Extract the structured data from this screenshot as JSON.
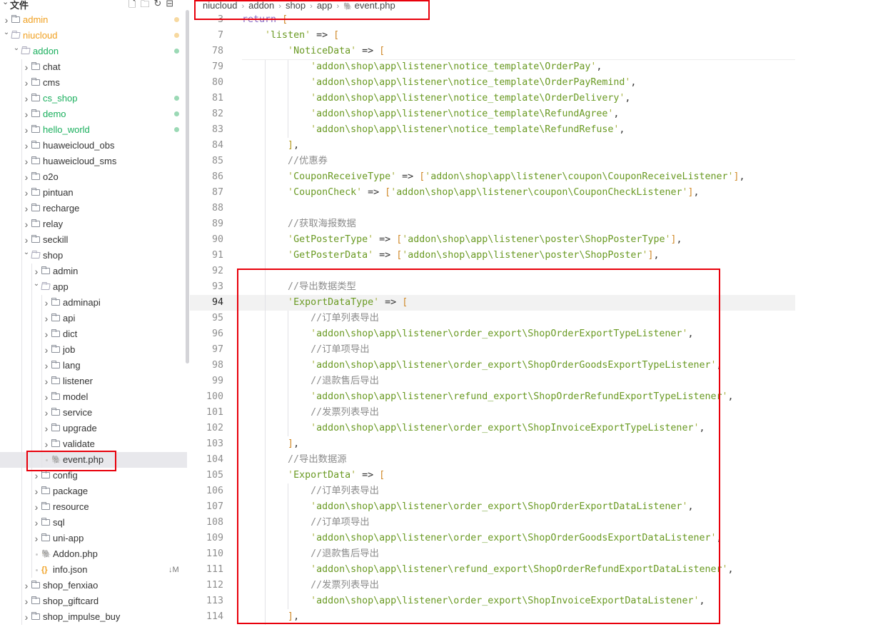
{
  "sidebar": {
    "title": "文件",
    "header_icons": [
      "new-file-icon",
      "new-folder-icon",
      "refresh-icon",
      "collapse-all-icon"
    ],
    "items": [
      {
        "label": "admin",
        "depth": 0,
        "type": "folder",
        "open": false,
        "color": "#f0a020",
        "badge_color": "#f7d9a0"
      },
      {
        "label": "niucloud",
        "depth": 0,
        "type": "folder",
        "open": true,
        "color": "#f0a020",
        "badge_color": "#f7d9a0"
      },
      {
        "label": "addon",
        "depth": 1,
        "type": "folder",
        "open": true,
        "color": "#1aaf5d",
        "badge_color": "#9bd9b5"
      },
      {
        "label": "chat",
        "depth": 2,
        "type": "folder",
        "open": false
      },
      {
        "label": "cms",
        "depth": 2,
        "type": "folder",
        "open": false
      },
      {
        "label": "cs_shop",
        "depth": 2,
        "type": "folder",
        "open": false,
        "color": "#1aaf5d",
        "badge_color": "#9bd9b5"
      },
      {
        "label": "demo",
        "depth": 2,
        "type": "folder",
        "open": false,
        "color": "#1aaf5d",
        "badge_color": "#9bd9b5"
      },
      {
        "label": "hello_world",
        "depth": 2,
        "type": "folder",
        "open": false,
        "color": "#1aaf5d",
        "badge_color": "#9bd9b5"
      },
      {
        "label": "huaweicloud_obs",
        "depth": 2,
        "type": "folder",
        "open": false
      },
      {
        "label": "huaweicloud_sms",
        "depth": 2,
        "type": "folder",
        "open": false
      },
      {
        "label": "o2o",
        "depth": 2,
        "type": "folder",
        "open": false
      },
      {
        "label": "pintuan",
        "depth": 2,
        "type": "folder",
        "open": false
      },
      {
        "label": "recharge",
        "depth": 2,
        "type": "folder",
        "open": false
      },
      {
        "label": "relay",
        "depth": 2,
        "type": "folder",
        "open": false
      },
      {
        "label": "seckill",
        "depth": 2,
        "type": "folder",
        "open": false
      },
      {
        "label": "shop",
        "depth": 2,
        "type": "folder",
        "open": true
      },
      {
        "label": "admin",
        "depth": 3,
        "type": "folder",
        "open": false
      },
      {
        "label": "app",
        "depth": 3,
        "type": "folder",
        "open": true
      },
      {
        "label": "adminapi",
        "depth": 4,
        "type": "folder",
        "open": false
      },
      {
        "label": "api",
        "depth": 4,
        "type": "folder",
        "open": false
      },
      {
        "label": "dict",
        "depth": 4,
        "type": "folder",
        "open": false
      },
      {
        "label": "job",
        "depth": 4,
        "type": "folder",
        "open": false
      },
      {
        "label": "lang",
        "depth": 4,
        "type": "folder",
        "open": false
      },
      {
        "label": "listener",
        "depth": 4,
        "type": "folder",
        "open": false
      },
      {
        "label": "model",
        "depth": 4,
        "type": "folder",
        "open": false
      },
      {
        "label": "service",
        "depth": 4,
        "type": "folder",
        "open": false
      },
      {
        "label": "upgrade",
        "depth": 4,
        "type": "folder",
        "open": false
      },
      {
        "label": "validate",
        "depth": 4,
        "type": "folder",
        "open": false
      },
      {
        "label": "event.php",
        "depth": 4,
        "type": "php",
        "selected": true
      },
      {
        "label": "config",
        "depth": 3,
        "type": "folder",
        "open": false
      },
      {
        "label": "package",
        "depth": 3,
        "type": "folder",
        "open": false
      },
      {
        "label": "resource",
        "depth": 3,
        "type": "folder",
        "open": false
      },
      {
        "label": "sql",
        "depth": 3,
        "type": "folder",
        "open": false
      },
      {
        "label": "uni-app",
        "depth": 3,
        "type": "folder",
        "open": false
      },
      {
        "label": "Addon.php",
        "depth": 3,
        "type": "php"
      },
      {
        "label": "info.json",
        "depth": 3,
        "type": "json",
        "badge_text": "↓M"
      },
      {
        "label": "shop_fenxiao",
        "depth": 2,
        "type": "folder",
        "open": false
      },
      {
        "label": "shop_giftcard",
        "depth": 2,
        "type": "folder",
        "open": false
      },
      {
        "label": "shop_impulse_buy",
        "depth": 2,
        "type": "folder",
        "open": false
      }
    ]
  },
  "breadcrumb": [
    "niucloud",
    "addon",
    "shop",
    "app",
    "event.php"
  ],
  "editor": {
    "current_line": 94,
    "lines": [
      {
        "n": 3,
        "i": 0,
        "s": [
          [
            "k",
            "return"
          ],
          [
            "o",
            " "
          ],
          [
            "b",
            "["
          ]
        ]
      },
      {
        "n": 7,
        "i": 1,
        "s": [
          [
            "q",
            "'"
          ],
          [
            "s",
            "listen"
          ],
          [
            "q",
            "'"
          ],
          [
            "o",
            " => "
          ],
          [
            "b",
            "["
          ]
        ]
      },
      {
        "n": 78,
        "i": 2,
        "s": [
          [
            "q",
            "'"
          ],
          [
            "s",
            "NoticeData"
          ],
          [
            "q",
            "'"
          ],
          [
            "o",
            " => "
          ],
          [
            "b",
            "["
          ]
        ]
      },
      {
        "n": 79,
        "i": 3,
        "s": [
          [
            "q",
            "'"
          ],
          [
            "s",
            "addon\\shop\\app\\listener\\notice_template\\OrderPay"
          ],
          [
            "q",
            "'"
          ],
          [
            "o",
            ","
          ]
        ]
      },
      {
        "n": 80,
        "i": 3,
        "s": [
          [
            "q",
            "'"
          ],
          [
            "s",
            "addon\\shop\\app\\listener\\notice_template\\OrderPayRemind"
          ],
          [
            "q",
            "'"
          ],
          [
            "o",
            ","
          ]
        ]
      },
      {
        "n": 81,
        "i": 3,
        "s": [
          [
            "q",
            "'"
          ],
          [
            "s",
            "addon\\shop\\app\\listener\\notice_template\\OrderDelivery"
          ],
          [
            "q",
            "'"
          ],
          [
            "o",
            ","
          ]
        ]
      },
      {
        "n": 82,
        "i": 3,
        "s": [
          [
            "q",
            "'"
          ],
          [
            "s",
            "addon\\shop\\app\\listener\\notice_template\\RefundAgree"
          ],
          [
            "q",
            "'"
          ],
          [
            "o",
            ","
          ]
        ]
      },
      {
        "n": 83,
        "i": 3,
        "s": [
          [
            "q",
            "'"
          ],
          [
            "s",
            "addon\\shop\\app\\listener\\notice_template\\RefundRefuse"
          ],
          [
            "q",
            "'"
          ],
          [
            "o",
            ","
          ]
        ]
      },
      {
        "n": 84,
        "i": 2,
        "s": [
          [
            "p",
            "]"
          ],
          [
            "o",
            ","
          ]
        ]
      },
      {
        "n": 85,
        "i": 2,
        "s": [
          [
            "c",
            "//优惠券"
          ]
        ]
      },
      {
        "n": 86,
        "i": 2,
        "s": [
          [
            "q",
            "'"
          ],
          [
            "s",
            "CouponReceiveType"
          ],
          [
            "q",
            "'"
          ],
          [
            "o",
            " => "
          ],
          [
            "b",
            "["
          ],
          [
            "q",
            "'"
          ],
          [
            "s",
            "addon\\shop\\app\\listener\\coupon\\CouponReceiveListener"
          ],
          [
            "q",
            "'"
          ],
          [
            "b",
            "]"
          ],
          [
            "o",
            ","
          ]
        ]
      },
      {
        "n": 87,
        "i": 2,
        "s": [
          [
            "q",
            "'"
          ],
          [
            "s",
            "CouponCheck"
          ],
          [
            "q",
            "'"
          ],
          [
            "o",
            " => "
          ],
          [
            "b",
            "["
          ],
          [
            "q",
            "'"
          ],
          [
            "s",
            "addon\\shop\\app\\listener\\coupon\\CouponCheckListener"
          ],
          [
            "q",
            "'"
          ],
          [
            "b",
            "]"
          ],
          [
            "o",
            ","
          ]
        ]
      },
      {
        "n": 88,
        "i": 2,
        "s": []
      },
      {
        "n": 89,
        "i": 2,
        "s": [
          [
            "c",
            "//获取海报数据"
          ]
        ]
      },
      {
        "n": 90,
        "i": 2,
        "s": [
          [
            "q",
            "'"
          ],
          [
            "s",
            "GetPosterType"
          ],
          [
            "q",
            "'"
          ],
          [
            "o",
            " => "
          ],
          [
            "b",
            "["
          ],
          [
            "q",
            "'"
          ],
          [
            "s",
            "addon\\shop\\app\\listener\\poster\\ShopPosterType"
          ],
          [
            "q",
            "'"
          ],
          [
            "b",
            "]"
          ],
          [
            "o",
            ","
          ]
        ]
      },
      {
        "n": 91,
        "i": 2,
        "s": [
          [
            "q",
            "'"
          ],
          [
            "s",
            "GetPosterData"
          ],
          [
            "q",
            "'"
          ],
          [
            "o",
            " => "
          ],
          [
            "b",
            "["
          ],
          [
            "q",
            "'"
          ],
          [
            "s",
            "addon\\shop\\app\\listener\\poster\\ShopPoster"
          ],
          [
            "q",
            "'"
          ],
          [
            "b",
            "]"
          ],
          [
            "o",
            ","
          ]
        ]
      },
      {
        "n": 92,
        "i": 2,
        "s": []
      },
      {
        "n": 93,
        "i": 2,
        "s": [
          [
            "c",
            "//导出数据类型"
          ]
        ]
      },
      {
        "n": 94,
        "i": 2,
        "s": [
          [
            "q",
            "'"
          ],
          [
            "s",
            "ExportDataType"
          ],
          [
            "q",
            "'"
          ],
          [
            "o",
            " => "
          ],
          [
            "b",
            "["
          ]
        ]
      },
      {
        "n": 95,
        "i": 3,
        "s": [
          [
            "c",
            "//订单列表导出"
          ]
        ]
      },
      {
        "n": 96,
        "i": 3,
        "s": [
          [
            "q",
            "'"
          ],
          [
            "s",
            "addon\\shop\\app\\listener\\order_export\\ShopOrderExportTypeListener"
          ],
          [
            "q",
            "'"
          ],
          [
            "o",
            ","
          ]
        ]
      },
      {
        "n": 97,
        "i": 3,
        "s": [
          [
            "c",
            "//订单项导出"
          ]
        ]
      },
      {
        "n": 98,
        "i": 3,
        "s": [
          [
            "q",
            "'"
          ],
          [
            "s",
            "addon\\shop\\app\\listener\\order_export\\ShopOrderGoodsExportTypeListener"
          ],
          [
            "q",
            "'"
          ],
          [
            "o",
            ","
          ]
        ]
      },
      {
        "n": 99,
        "i": 3,
        "s": [
          [
            "c",
            "//退款售后导出"
          ]
        ]
      },
      {
        "n": 100,
        "i": 3,
        "s": [
          [
            "q",
            "'"
          ],
          [
            "s",
            "addon\\shop\\app\\listener\\refund_export\\ShopOrderRefundExportTypeListener"
          ],
          [
            "q",
            "'"
          ],
          [
            "o",
            ","
          ]
        ]
      },
      {
        "n": 101,
        "i": 3,
        "s": [
          [
            "c",
            "//发票列表导出"
          ]
        ]
      },
      {
        "n": 102,
        "i": 3,
        "s": [
          [
            "q",
            "'"
          ],
          [
            "s",
            "addon\\shop\\app\\listener\\order_export\\ShopInvoiceExportTypeListener"
          ],
          [
            "q",
            "'"
          ],
          [
            "o",
            ","
          ]
        ]
      },
      {
        "n": 103,
        "i": 2,
        "s": [
          [
            "b",
            "]"
          ],
          [
            "o",
            ","
          ]
        ]
      },
      {
        "n": 104,
        "i": 2,
        "s": [
          [
            "c",
            "//导出数据源"
          ]
        ]
      },
      {
        "n": 105,
        "i": 2,
        "s": [
          [
            "q",
            "'"
          ],
          [
            "s",
            "ExportData"
          ],
          [
            "q",
            "'"
          ],
          [
            "o",
            " => "
          ],
          [
            "b",
            "["
          ]
        ]
      },
      {
        "n": 106,
        "i": 3,
        "s": [
          [
            "c",
            "//订单列表导出"
          ]
        ]
      },
      {
        "n": 107,
        "i": 3,
        "s": [
          [
            "q",
            "'"
          ],
          [
            "s",
            "addon\\shop\\app\\listener\\order_export\\ShopOrderExportDataListener"
          ],
          [
            "q",
            "'"
          ],
          [
            "o",
            ","
          ]
        ]
      },
      {
        "n": 108,
        "i": 3,
        "s": [
          [
            "c",
            "//订单项导出"
          ]
        ]
      },
      {
        "n": 109,
        "i": 3,
        "s": [
          [
            "q",
            "'"
          ],
          [
            "s",
            "addon\\shop\\app\\listener\\order_export\\ShopOrderGoodsExportDataListener"
          ],
          [
            "q",
            "'"
          ],
          [
            "o",
            ","
          ]
        ]
      },
      {
        "n": 110,
        "i": 3,
        "s": [
          [
            "c",
            "//退款售后导出"
          ]
        ]
      },
      {
        "n": 111,
        "i": 3,
        "s": [
          [
            "q",
            "'"
          ],
          [
            "s",
            "addon\\shop\\app\\listener\\refund_export\\ShopOrderRefundExportDataListener"
          ],
          [
            "q",
            "'"
          ],
          [
            "o",
            ","
          ]
        ]
      },
      {
        "n": 112,
        "i": 3,
        "s": [
          [
            "c",
            "//发票列表导出"
          ]
        ]
      },
      {
        "n": 113,
        "i": 3,
        "s": [
          [
            "q",
            "'"
          ],
          [
            "s",
            "addon\\shop\\app\\listener\\order_export\\ShopInvoiceExportDataListener"
          ],
          [
            "q",
            "'"
          ],
          [
            "o",
            ","
          ]
        ]
      },
      {
        "n": 114,
        "i": 2,
        "s": [
          [
            "b",
            "]"
          ],
          [
            "o",
            ","
          ]
        ]
      }
    ]
  },
  "colors": {
    "highlight_box": "#e8000b",
    "modified": "#f0a020",
    "untracked": "#1aaf5d"
  }
}
